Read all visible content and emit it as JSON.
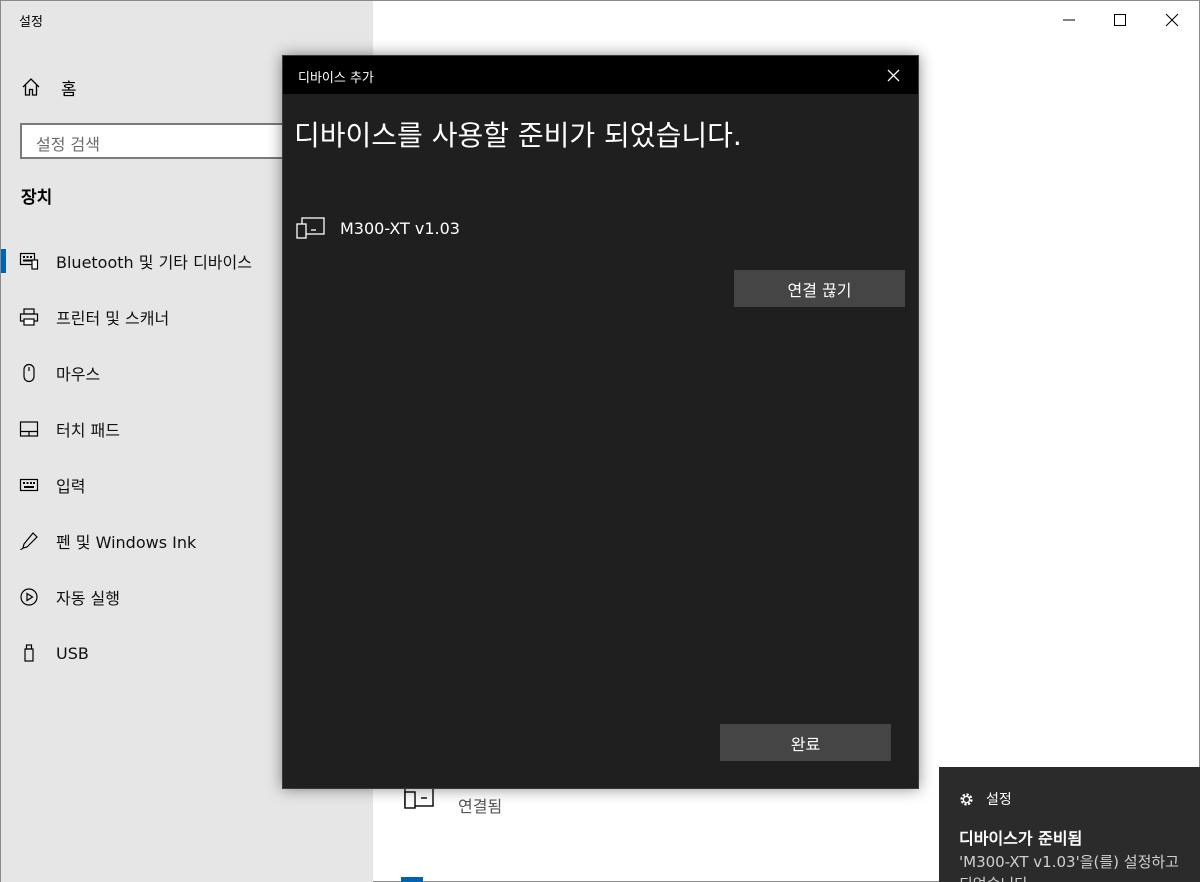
{
  "window": {
    "title": "설정",
    "controls": [
      "minimize",
      "maximize",
      "close"
    ]
  },
  "sidebar": {
    "home_label": "홈",
    "search_placeholder": "설정 검색",
    "section_title": "장치",
    "items": [
      {
        "label": "Bluetooth 및 기타 디바이스",
        "icon": "bluetooth-devices-icon",
        "active": true
      },
      {
        "label": "프린터 및 스캐너",
        "icon": "printer-icon"
      },
      {
        "label": "마우스",
        "icon": "mouse-icon"
      },
      {
        "label": "터치 패드",
        "icon": "touchpad-icon"
      },
      {
        "label": "입력",
        "icon": "keyboard-icon"
      },
      {
        "label": "펜 및 Windows Ink",
        "icon": "pen-icon"
      },
      {
        "label": "자동 실행",
        "icon": "autoplay-icon"
      },
      {
        "label": "USB",
        "icon": "usb-icon"
      }
    ]
  },
  "background": {
    "device_status": "연결됨"
  },
  "dialog": {
    "title": "디바이스 추가",
    "heading": "디바이스를 사용할 준비가 되었습니다.",
    "device_name": "M300-XT v1.03",
    "disconnect_label": "연결 끊기",
    "done_label": "완료"
  },
  "toast": {
    "app": "설정",
    "title": "디바이스가 준비됨",
    "body_line1": "'M300-XT v1.03'을(를) 설정하고",
    "body_line2": "되었습니다"
  },
  "colors": {
    "sidebar_bg": "#e6e6e6",
    "accent": "#0063b1",
    "dialog_bg": "#1f1f1f",
    "dialog_titlebar": "#000000",
    "button_bg": "#454545",
    "toast_bg": "#2b2b2b"
  }
}
